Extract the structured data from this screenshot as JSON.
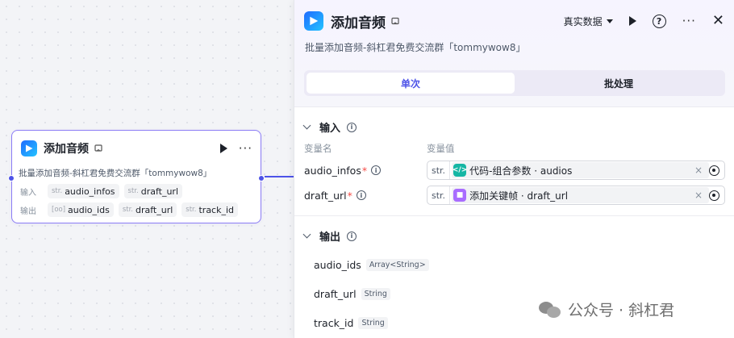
{
  "node": {
    "title": "添加音频",
    "description": "批量添加音频-斜杠君免费交流群「tommywow8」",
    "input_label": "输入",
    "output_label": "输出",
    "inputs": [
      {
        "type": "str.",
        "name": "audio_infos"
      },
      {
        "type": "str.",
        "name": "draft_url"
      }
    ],
    "outputs": [
      {
        "type": "[oo]",
        "name": "audio_ids"
      },
      {
        "type": "str.",
        "name": "draft_url"
      },
      {
        "type": "str.",
        "name": "track_id"
      }
    ]
  },
  "panel": {
    "title": "添加音频",
    "description": "批量添加音频-斜杠君免费交流群「tommywow8」",
    "data_select": "真实数据",
    "tabs": [
      {
        "label": "单次",
        "active": true
      },
      {
        "label": "批处理",
        "active": false
      }
    ],
    "input_section": {
      "title": "输入",
      "col_name": "变量名",
      "col_value": "变量值",
      "params": [
        {
          "name": "audio_infos",
          "type": "str.",
          "ref_node": "代码-组合参数",
          "ref_sep": " · ",
          "ref_var": "audios",
          "ref_icon": "code-icon"
        },
        {
          "name": "draft_url",
          "type": "str.",
          "ref_node": "添加关键帧",
          "ref_sep": " · ",
          "ref_var": "draft_url",
          "ref_icon": "cube-icon"
        }
      ]
    },
    "output_section": {
      "title": "输出",
      "outputs": [
        {
          "name": "audio_ids",
          "type": "Array<String>"
        },
        {
          "name": "draft_url",
          "type": "String"
        },
        {
          "name": "track_id",
          "type": "String"
        }
      ]
    }
  },
  "watermark": {
    "text": "公众号 · 斜杠君"
  },
  "colors": {
    "accent": "#4d53e8",
    "node_border": "#8b7cf5",
    "required": "#f54a45"
  }
}
